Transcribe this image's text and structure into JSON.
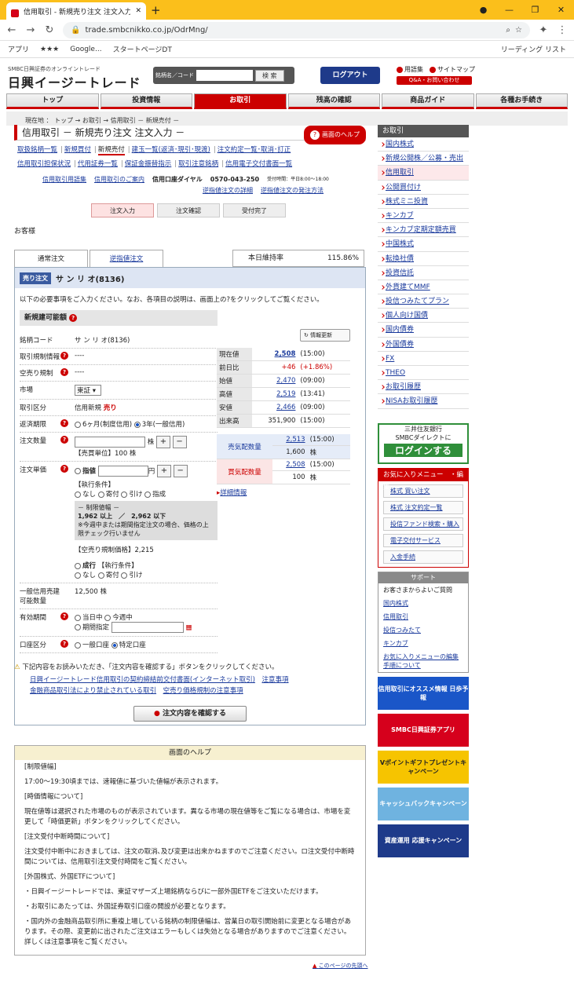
{
  "browser": {
    "tab_title": "信用取引 - 新規売り注文 注文入力",
    "url": "trade.smbcnikko.co.jp/OdrMng/",
    "bookmarks": [
      "アプリ",
      "★★★",
      "Google...",
      "スタートページDT"
    ],
    "reading_list": "リーディング リスト"
  },
  "header": {
    "logo_small": "SMBC日興証券のオンライントレード",
    "logo": "日興イージートレード",
    "search_label": "銘柄名／コード",
    "search_btn": "検 索",
    "logout": "ログアウト",
    "glossary": "用語集",
    "sitemap": "サイトマップ",
    "qa": "Q&A・お問い合わせ"
  },
  "gnav": [
    "トップ",
    "投資情報",
    "お取引",
    "残高の確認",
    "商品ガイド",
    "各種お手続き"
  ],
  "crumb": "現在地 ： トップ → お取引 → 信用取引 － 新規売付 －",
  "page": {
    "title": "信用取引 － 新規売り注文 注文入力 －",
    "help": "画面のヘルプ"
  },
  "sublinks1": [
    "取扱銘柄一覧",
    "新規買付",
    "新規売付",
    "建玉一覧(返済･現引･現渡)",
    "注文約定一覧･取消･訂正"
  ],
  "sublinks2": [
    "信用取引担保状況",
    "代用証券一覧",
    "保証金振替指示",
    "取引注意銘柄",
    "信用電子交付書面一覧"
  ],
  "info": {
    "glossary": "信用取引用語集",
    "guide": "信用取引のご案内",
    "dial_label": "信用口座ダイヤル",
    "dial": "0570-043-250",
    "hours": "受付時間：平日8:00～18:00",
    "stop1": "逆指値注文の詳細",
    "stop2": "逆指値注文の発注方法"
  },
  "steps": [
    "注文入力",
    "注文確認",
    "受付完了"
  ],
  "customer": "お客様",
  "tabs": {
    "normal": "通常注文",
    "stop": "逆指値注文",
    "rate_label": "本日維持率",
    "rate": "115.86%"
  },
  "stock": {
    "badge": "売り注文",
    "name": "サ ン リ オ(8136)"
  },
  "note": "以下の必要事項をご入力ください。なお、各項目の説明は、画面上の?をクリックしてご覧ください。",
  "section": "新規建可能額",
  "form": {
    "code_k": "銘柄コード",
    "code_v": "サ ン リ オ(8136)",
    "rule_k": "取引規制情報",
    "rule_v": "----",
    "short_k": "空売り規制",
    "short_v": "----",
    "market_k": "市場",
    "market_v": "東証",
    "kind_k": "取引区分",
    "kind_v": "信用新規",
    "kind_s": "売り",
    "due_k": "返済期限",
    "due_1": "6ヶ月(制度信用)",
    "due_2": "3年(一般信用)",
    "qty_k": "注文数量",
    "qty_unit": "株",
    "qty_note": "【売買単位】100 株",
    "price_k": "注文単価",
    "limit": "指値",
    "yen": "円",
    "cond": "【執行条件】",
    "c1": "なし",
    "c2": "寄付",
    "c3": "引け",
    "c4": "指成",
    "range_t": "－ 制限値幅 －",
    "range_v": "1,962 以上　／　2,962 以下",
    "range_n": "※今週中または期間指定注文の場合、価格の上限チェック行いません",
    "short_price": "【空売り規制価格】2,215",
    "market": "成行",
    "gen_k": "一般信用売建可能数量",
    "gen_v": "12,500 株",
    "term_k": "有効期間",
    "t1": "当日中",
    "t2": "今週中",
    "t3": "期間指定",
    "acc_k": "口座区分",
    "a1": "一般口座",
    "a2": "特定口座"
  },
  "quote": {
    "refresh": "情報更新",
    "cur_k": "現在値",
    "cur": "2,508",
    "cur_t": "(15:00)",
    "chg_k": "前日比",
    "chg": "+46",
    "chg_p": "(+1.86%)",
    "open_k": "始値",
    "open": "2,470",
    "open_t": "(09:00)",
    "high_k": "高値",
    "high": "2,519",
    "high_t": "(13:41)",
    "low_k": "安値",
    "low": "2,466",
    "low_t": "(09:00)",
    "vol_k": "出来高",
    "vol": "351,900",
    "vol_t": "(15:00)",
    "ask_k": "売気配数量",
    "ask": "2,513",
    "ask_q": "1,600",
    "ask_t": "(15:00)",
    "bid_k": "買気配数量",
    "bid": "2,508",
    "bid_q": "100",
    "bid_t": "(15:00)",
    "unit": "株",
    "detail": "詳細情報"
  },
  "bottom": {
    "warn": "下記内容をお読みいただき、「注文内容を確認する」ボタンをクリックしてください。",
    "l1": "日興イージートレード信用取引の契約締結前交付書面(インターネット取引)",
    "l2": "注意事項",
    "l3": "金融商品取引法により禁止されている取引",
    "l4": "空売り価格規制の注意事項",
    "confirm": "注文内容を確認する"
  },
  "helpbox": {
    "head": "画面のヘルプ",
    "p1h": "[制限値幅]",
    "p1": "17:00～19:30頃までは、速報値に基づいた値幅が表示されます。",
    "p2h": "[時価情報について]",
    "p2": "現在値等は選択された市場のものが表示されています。異なる市場の現在値等をご覧になる場合は、市場を変更して「時価更新」ボタンをクリックしてください。",
    "p3h": "[注文受付中断時間について]",
    "p3": "注文受付中断中におきましては、注文の取消､及び変更は出来かねますのでご注意ください。ロ注文受付中断時間については、信用取引注文受付時間をご覧ください。",
    "p4h": "[外国株式、外国ETFについて]",
    "p4a": "・日興イージートレードでは、東証マザーズ上場銘柄ならびに一部外国ETFをご注文いただけます。",
    "p4b": "・お取引にあたっては、外国証券取引口座の開設が必要となります。",
    "p4c": "・国内外の金融商品取引所に重複上場している銘柄の制限値幅は、営業日の取引開始前に変更となる場合があります。その際、変更前に出されたご注文はエラーもしくは失効となる場合がありますのでご注意ください。詳しくは注意事項をご覧ください。",
    "top": "このページの先頭へ"
  },
  "side": {
    "hd": "お取引",
    "items": [
      "国内株式",
      "新規公開株／公募・売出",
      "信用取引",
      "公開買付け",
      "株式ミニ投資",
      "キンカブ",
      "キンカブ定期定額売買",
      "中国株式",
      "転換社債",
      "投資信託",
      "外貨建てMMF",
      "投信つみたてプラン",
      "個人向け国債",
      "国内債券",
      "外国債券",
      "FX",
      "THEO",
      "お取引履歴",
      "NISAお取引履歴"
    ],
    "smbc1": "三井住友銀行",
    "smbc2": "SMBCダイレクトに",
    "smbc3": "ログインする",
    "fav_hd": "お気に入りメニュー　・編集",
    "fav": [
      "株式 買い注文",
      "株式 注文約定一覧",
      "投信ファンド検索・購入",
      "電子交付サービス",
      "入金手続"
    ],
    "sup_hd": "サポート",
    "sup_q": "お客さまからよいご質問",
    "sup": [
      "国内株式",
      "信用取引",
      "投信つみたて",
      "キンカブ",
      "お気に入りメニューの編集手順について"
    ],
    "b1": "信用取引にオススメ情報 日歩予報",
    "b2": "SMBC日興証券アプリ",
    "b3": "Vポイントギフトプレゼントキャンペーン",
    "b4": "キャッシュバックキャンペーン",
    "b5": "資産運用 応援キャンペーン"
  }
}
